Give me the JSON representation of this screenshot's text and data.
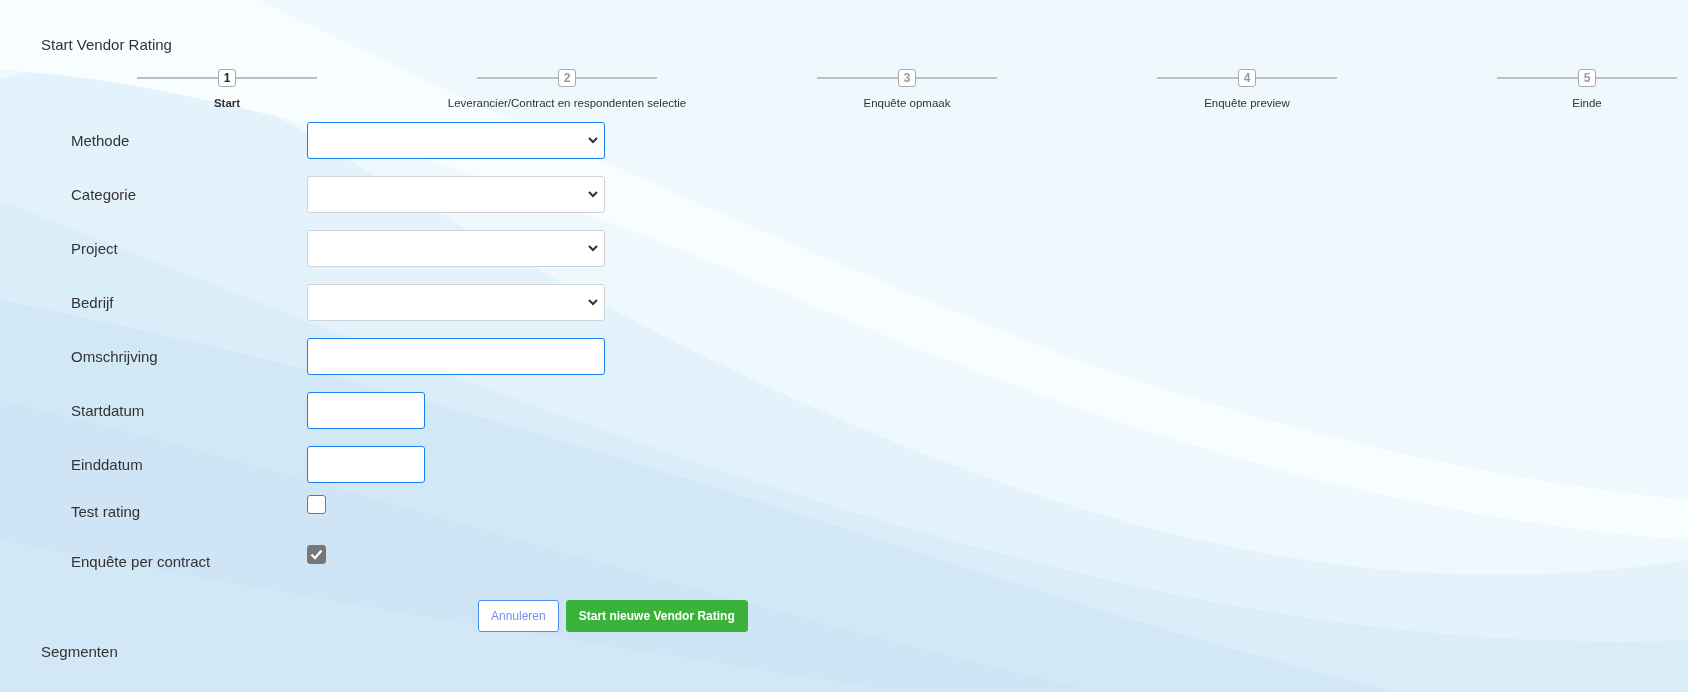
{
  "title": "Start Vendor Rating",
  "steps": [
    {
      "number": "1",
      "label": "Start",
      "selected": true
    },
    {
      "number": "2",
      "label": "Leverancier/Contract en respondenten selectie",
      "selected": false
    },
    {
      "number": "3",
      "label": "Enquête opmaak",
      "selected": false
    },
    {
      "number": "4",
      "label": "Enquête preview",
      "selected": false
    },
    {
      "number": "5",
      "label": "Einde",
      "selected": false
    }
  ],
  "form": [
    {
      "label": "Methode",
      "kind": "select",
      "highlighted": true
    },
    {
      "label": "Categorie",
      "kind": "select",
      "highlighted": false
    },
    {
      "label": "Project",
      "kind": "select",
      "highlighted": false
    },
    {
      "label": "Bedrijf",
      "kind": "select",
      "highlighted": false
    },
    {
      "label": "Omschrijving",
      "kind": "text",
      "highlighted": true
    },
    {
      "label": "Startdatum",
      "kind": "date",
      "highlighted": true
    },
    {
      "label": "Einddatum",
      "kind": "date",
      "highlighted": true
    },
    {
      "label": "Test rating",
      "kind": "checkbox",
      "checked": false
    },
    {
      "label": "Enquête per contract",
      "kind": "checkbox",
      "checked": true
    }
  ],
  "buttons": [
    {
      "label": "Annuleren",
      "kind": "secondary"
    },
    {
      "label": "Start nieuwe Vendor Rating",
      "kind": "primary"
    }
  ],
  "section": "Segmenten"
}
